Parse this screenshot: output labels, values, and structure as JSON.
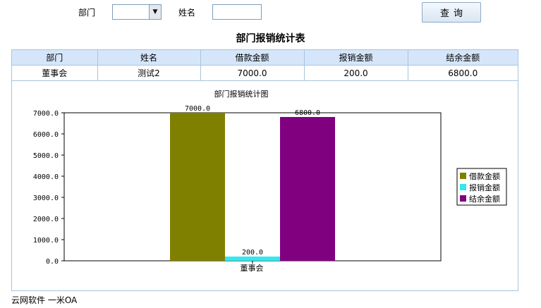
{
  "filters": {
    "dept_label": "部门",
    "dept_value": "",
    "name_label": "姓名",
    "name_value": ""
  },
  "query_button_label": "查询",
  "report_title": "部门报销统计表",
  "table": {
    "headers": [
      "部门",
      "姓名",
      "借款金额",
      "报销金额",
      "结余金额"
    ],
    "rows": [
      [
        "董事会",
        "测试2",
        "7000.0",
        "200.0",
        "6800.0"
      ]
    ]
  },
  "chart_data": {
    "type": "bar",
    "title": "部门报销统计图",
    "categories": [
      "董事会"
    ],
    "series": [
      {
        "name": "借款金额",
        "values": [
          7000.0
        ],
        "color": "#808000"
      },
      {
        "name": "报销金额",
        "values": [
          200.0
        ],
        "color": "#33e8ee"
      },
      {
        "name": "结余金额",
        "values": [
          6800.0
        ],
        "color": "#800080"
      }
    ],
    "data_labels": [
      "7000.0",
      "200.0",
      "6800.0"
    ],
    "y_ticks": [
      "0.0",
      "1000.0",
      "2000.0",
      "3000.0",
      "4000.0",
      "5000.0",
      "6000.0",
      "7000.0"
    ],
    "ylim": [
      0,
      7000
    ],
    "grid": false,
    "legend_position": "right"
  },
  "footer": "云网软件 一米OA"
}
